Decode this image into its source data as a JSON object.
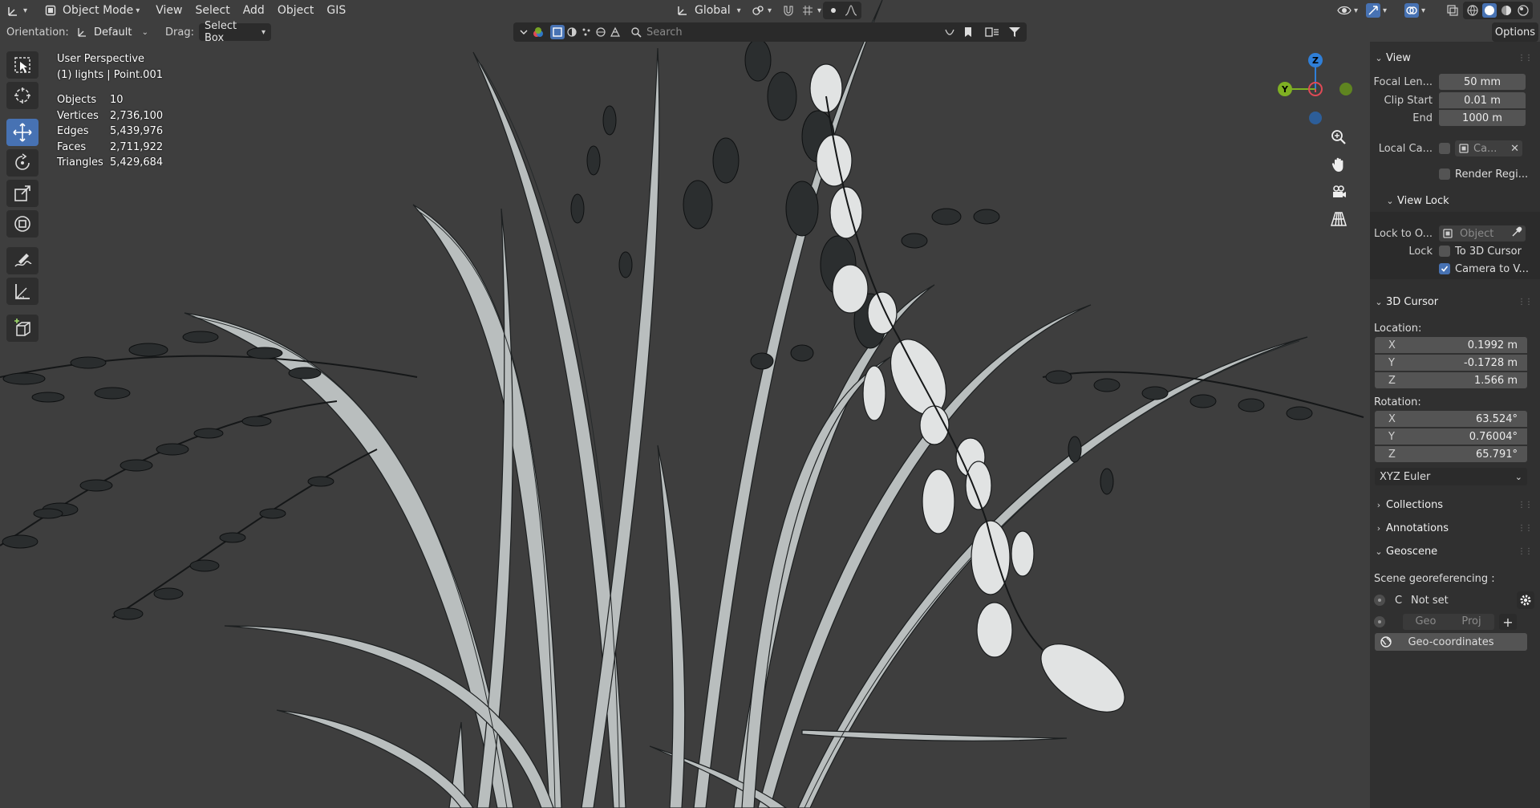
{
  "header": {
    "mode_label": "Object Mode",
    "menus": [
      "View",
      "Select",
      "Add",
      "Object",
      "GIS"
    ],
    "transform_orientation": "Global"
  },
  "tool_settings": {
    "orientation_label": "Orientation:",
    "orientation_value": "Default",
    "drag_label": "Drag:",
    "drag_value": "Select Box",
    "search_placeholder": "Search",
    "options_label": "Options"
  },
  "viewport": {
    "perspective": "User Perspective",
    "object_info": "(1) lights | Point.001",
    "stats": [
      {
        "label": "Objects",
        "value": "10"
      },
      {
        "label": "Vertices",
        "value": "2,736,100"
      },
      {
        "label": "Edges",
        "value": "5,439,976"
      },
      {
        "label": "Faces",
        "value": "2,711,922"
      },
      {
        "label": "Triangles",
        "value": "5,429,684"
      }
    ],
    "gizmo": {
      "z": "Z",
      "y": "Y",
      "x": "X"
    }
  },
  "sidebar": {
    "view": {
      "title": "View",
      "focal_length_label": "Focal Len...",
      "focal_length_value": "50 mm",
      "clip_start_label": "Clip Start",
      "clip_start_value": "0.01 m",
      "clip_end_label": "End",
      "clip_end_value": "1000 m",
      "local_camera_label": "Local Ca...",
      "local_camera_value": "Ca...",
      "render_region_label": "Render Regi..."
    },
    "view_lock": {
      "title": "View Lock",
      "lock_to_object_label": "Lock to O...",
      "lock_to_object_placeholder": "Object",
      "lock_label": "Lock",
      "to_3d_cursor_label": "To 3D Cursor",
      "camera_to_view_label": "Camera to V..."
    },
    "cursor": {
      "title": "3D Cursor",
      "location_label": "Location:",
      "location": [
        {
          "axis": "X",
          "value": "0.1992 m"
        },
        {
          "axis": "Y",
          "value": "-0.1728 m"
        },
        {
          "axis": "Z",
          "value": "1.566 m"
        }
      ],
      "rotation_label": "Rotation:",
      "rotation": [
        {
          "axis": "X",
          "value": "63.524°"
        },
        {
          "axis": "Y",
          "value": "0.76004°"
        },
        {
          "axis": "Z",
          "value": "65.791°"
        }
      ],
      "rotation_mode": "XYZ Euler"
    },
    "collections_title": "Collections",
    "annotations_title": "Annotations",
    "geoscene": {
      "title": "Geoscene",
      "georef_label": "Scene georeferencing :",
      "crs_letter": "C",
      "crs_value": "Not set",
      "geo_label": "Geo",
      "proj_label": "Proj",
      "geocoords_button": "Geo-coordinates"
    }
  },
  "colors": {
    "accent": "#4772b3",
    "axis_x": "#e04a56",
    "axis_y": "#7fb023",
    "axis_z": "#2f7fd8"
  }
}
